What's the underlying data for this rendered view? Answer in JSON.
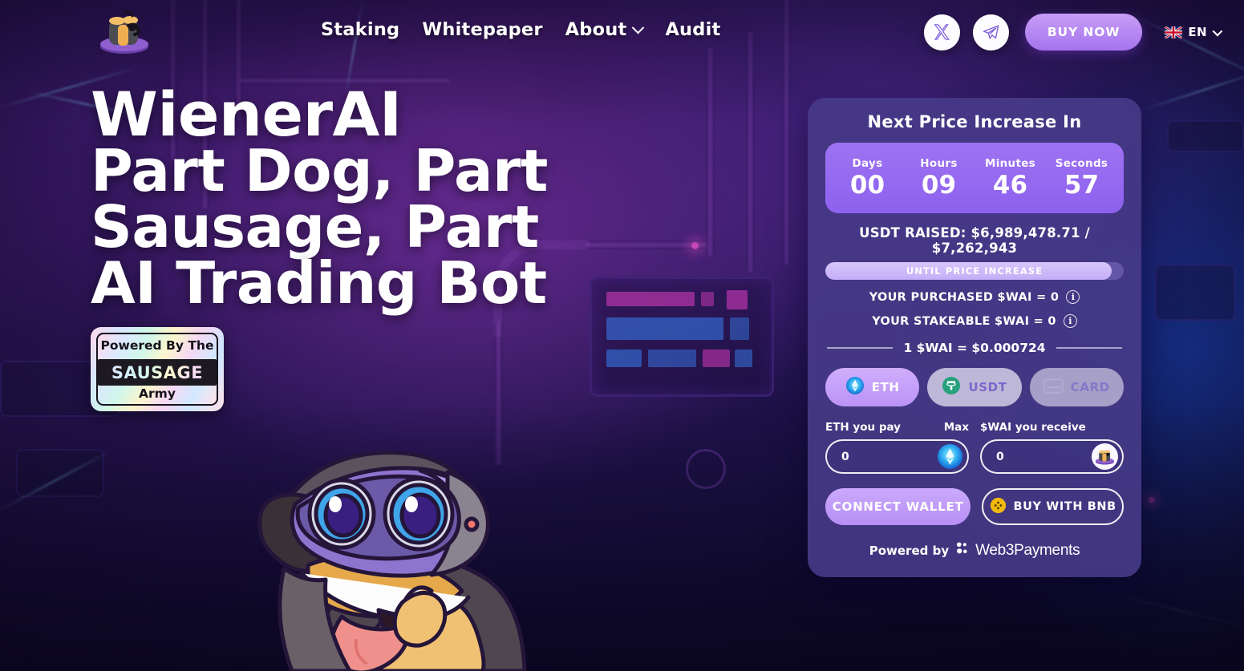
{
  "brand": {
    "logo_icon": "sausage-plate-logo",
    "name": "WienerAI"
  },
  "nav": {
    "items": [
      {
        "label": "Staking",
        "name": "nav-staking"
      },
      {
        "label": "Whitepaper",
        "name": "nav-whitepaper"
      },
      {
        "label": "About",
        "name": "nav-about",
        "has_dropdown": true
      },
      {
        "label": "Audit",
        "name": "nav-audit"
      }
    ]
  },
  "header": {
    "social": [
      {
        "icon": "x-twitter-icon",
        "name": "social-x"
      },
      {
        "icon": "telegram-icon",
        "name": "social-telegram"
      }
    ],
    "buy_now_label": "BUY NOW",
    "language": {
      "code": "EN",
      "flag_icon": "uk-flag-icon",
      "chevron_icon": "chevron-down-icon"
    }
  },
  "hero": {
    "line1": "WienerAI",
    "line2": "Part Dog, Part Sausage, Part",
    "line3": "AI Trading Bot",
    "badge": {
      "top": "Powered By The",
      "middle": "SAUSAGE",
      "bottom": "Army"
    },
    "mascot_icon": "dachshund-vr-mascot"
  },
  "presale": {
    "title": "Next Price Increase In",
    "countdown": [
      {
        "label": "Days",
        "value": "00"
      },
      {
        "label": "Hours",
        "value": "09"
      },
      {
        "label": "Minutes",
        "value": "46"
      },
      {
        "label": "Seconds",
        "value": "57"
      }
    ],
    "raised_text": "USDT RAISED: $6,989,478.71 / $7,262,943",
    "raised_current": 6989478.71,
    "raised_target": 7262943,
    "progress_percent": 96,
    "progress_label": "UNTIL PRICE INCREASE",
    "stats": [
      {
        "text": "YOUR PURCHASED $WAI = 0",
        "info_icon": "info-icon"
      },
      {
        "text": "YOUR STAKEABLE $WAI = 0",
        "info_icon": "info-icon"
      }
    ],
    "rate": "1 $WAI = $0.000724",
    "pay_methods": [
      {
        "label": "ETH",
        "icon": "ethereum-icon",
        "active": true
      },
      {
        "label": "USDT",
        "icon": "tether-icon",
        "active": false
      },
      {
        "label": "CARD",
        "icon": "credit-card-icon",
        "active": false
      }
    ],
    "pay_field": {
      "label": "ETH you pay",
      "value": "0",
      "placeholder": "0",
      "max_label": "Max",
      "icon": "ethereum-icon"
    },
    "receive_field": {
      "label": "$WAI you receive",
      "value": "0",
      "placeholder": "0",
      "icon": "wai-token-icon"
    },
    "connect_label": "CONNECT WALLET",
    "bnb_label": "BUY WITH BNB",
    "bnb_icon": "bnb-coin-icon",
    "powered_prefix": "Powered by",
    "powered_brand": "Web3Payments",
    "powered_icon": "web3payments-icon"
  },
  "colors": {
    "accent_purple": "#a574ee",
    "timer_purple": "#8e61ee",
    "card_bg": "#463a87",
    "tether_green": "#26a17b",
    "bnb_yellow": "#f0b90b",
    "eth_blue": "#2aa7ef"
  }
}
